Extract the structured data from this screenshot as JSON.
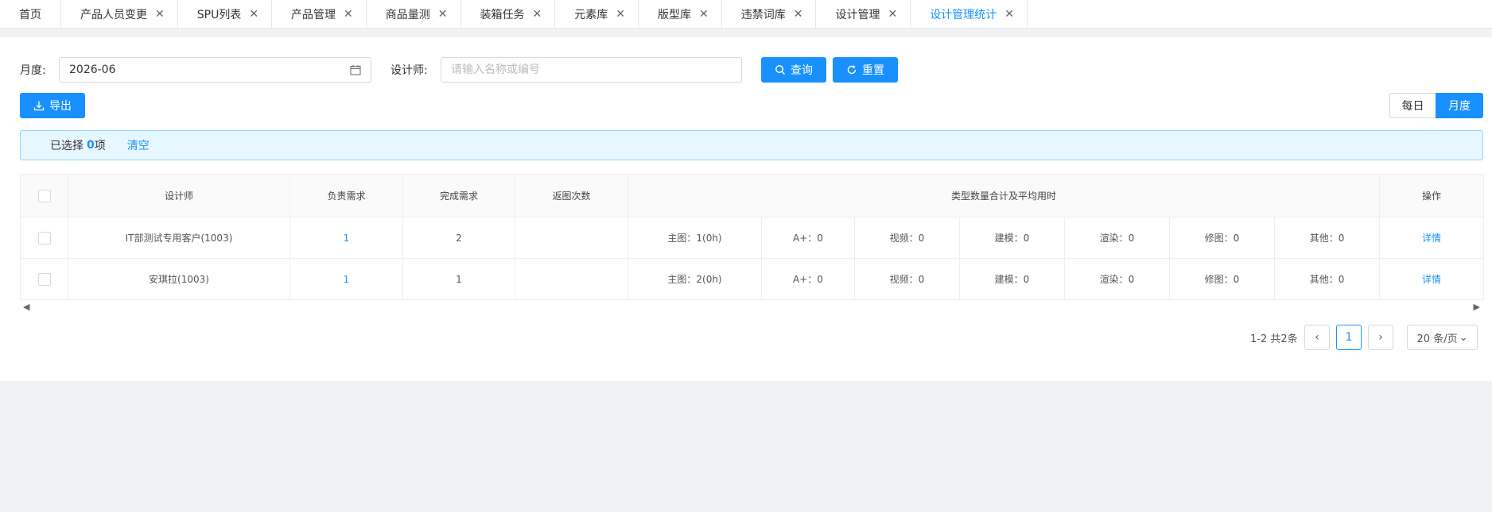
{
  "tabs": [
    {
      "label": "首页",
      "closable": false,
      "active": false
    },
    {
      "label": "产品人员变更",
      "closable": true,
      "active": false
    },
    {
      "label": "SPU列表",
      "closable": true,
      "active": false
    },
    {
      "label": "产品管理",
      "closable": true,
      "active": false
    },
    {
      "label": "商品量测",
      "closable": true,
      "active": false
    },
    {
      "label": "装箱任务",
      "closable": true,
      "active": false
    },
    {
      "label": "元素库",
      "closable": true,
      "active": false
    },
    {
      "label": "版型库",
      "closable": true,
      "active": false
    },
    {
      "label": "违禁词库",
      "closable": true,
      "active": false
    },
    {
      "label": "设计管理",
      "closable": true,
      "active": false
    },
    {
      "label": "设计管理统计",
      "closable": true,
      "active": true
    }
  ],
  "filters": {
    "month_label": "月度:",
    "month_value": "2026-06",
    "designer_label": "设计师:",
    "designer_placeholder": "请输入名称或编号",
    "query_button": "查询",
    "reset_button": "重置",
    "export_button": "导出"
  },
  "view_toggle": {
    "daily": "每日",
    "monthly": "月度",
    "selected": "monthly"
  },
  "selection": {
    "prefix": "已选择",
    "count": "0",
    "suffix": "项",
    "clear": "清空"
  },
  "table": {
    "headers": {
      "designer": "设计师",
      "responsible": "负责需求",
      "completed": "完成需求",
      "returned": "返图次数",
      "types": "类型数量合计及平均用时",
      "action": "操作"
    },
    "rows": [
      {
        "designer": "IT部测试专用客户(1003)",
        "responsible": "1",
        "completed": "2",
        "returned": "",
        "main": "主图：1(0h)",
        "aplus": "A+：0",
        "video": "视频：0",
        "model": "建模：0",
        "render": "渲染：0",
        "retouch": "修图：0",
        "other": "其他：0",
        "action": "详情"
      },
      {
        "designer": "安琪拉(1003)",
        "responsible": "1",
        "completed": "1",
        "returned": "",
        "main": "主图：2(0h)",
        "aplus": "A+：0",
        "video": "视频：0",
        "model": "建模：0",
        "render": "渲染：0",
        "retouch": "修图：0",
        "other": "其他：0",
        "action": "详情"
      }
    ]
  },
  "pagination": {
    "summary": "1-2 共2条",
    "current_page": "1",
    "page_size": "20 条/页"
  },
  "colors": {
    "primary": "#1890ff",
    "page_bg": "#f0f2f5",
    "selection_bg": "#e6f7ff"
  }
}
